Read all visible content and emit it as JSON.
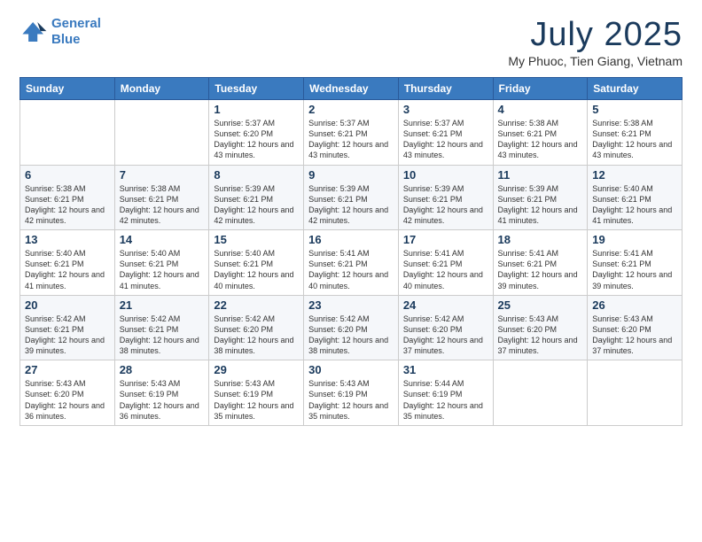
{
  "logo": {
    "line1": "General",
    "line2": "Blue"
  },
  "title": "July 2025",
  "subtitle": "My Phuoc, Tien Giang, Vietnam",
  "days_of_week": [
    "Sunday",
    "Monday",
    "Tuesday",
    "Wednesday",
    "Thursday",
    "Friday",
    "Saturday"
  ],
  "weeks": [
    [
      {
        "day": "",
        "content": ""
      },
      {
        "day": "",
        "content": ""
      },
      {
        "day": "1",
        "content": "Sunrise: 5:37 AM\nSunset: 6:20 PM\nDaylight: 12 hours and 43 minutes."
      },
      {
        "day": "2",
        "content": "Sunrise: 5:37 AM\nSunset: 6:21 PM\nDaylight: 12 hours and 43 minutes."
      },
      {
        "day": "3",
        "content": "Sunrise: 5:37 AM\nSunset: 6:21 PM\nDaylight: 12 hours and 43 minutes."
      },
      {
        "day": "4",
        "content": "Sunrise: 5:38 AM\nSunset: 6:21 PM\nDaylight: 12 hours and 43 minutes."
      },
      {
        "day": "5",
        "content": "Sunrise: 5:38 AM\nSunset: 6:21 PM\nDaylight: 12 hours and 43 minutes."
      }
    ],
    [
      {
        "day": "6",
        "content": "Sunrise: 5:38 AM\nSunset: 6:21 PM\nDaylight: 12 hours and 42 minutes."
      },
      {
        "day": "7",
        "content": "Sunrise: 5:38 AM\nSunset: 6:21 PM\nDaylight: 12 hours and 42 minutes."
      },
      {
        "day": "8",
        "content": "Sunrise: 5:39 AM\nSunset: 6:21 PM\nDaylight: 12 hours and 42 minutes."
      },
      {
        "day": "9",
        "content": "Sunrise: 5:39 AM\nSunset: 6:21 PM\nDaylight: 12 hours and 42 minutes."
      },
      {
        "day": "10",
        "content": "Sunrise: 5:39 AM\nSunset: 6:21 PM\nDaylight: 12 hours and 42 minutes."
      },
      {
        "day": "11",
        "content": "Sunrise: 5:39 AM\nSunset: 6:21 PM\nDaylight: 12 hours and 41 minutes."
      },
      {
        "day": "12",
        "content": "Sunrise: 5:40 AM\nSunset: 6:21 PM\nDaylight: 12 hours and 41 minutes."
      }
    ],
    [
      {
        "day": "13",
        "content": "Sunrise: 5:40 AM\nSunset: 6:21 PM\nDaylight: 12 hours and 41 minutes."
      },
      {
        "day": "14",
        "content": "Sunrise: 5:40 AM\nSunset: 6:21 PM\nDaylight: 12 hours and 41 minutes."
      },
      {
        "day": "15",
        "content": "Sunrise: 5:40 AM\nSunset: 6:21 PM\nDaylight: 12 hours and 40 minutes."
      },
      {
        "day": "16",
        "content": "Sunrise: 5:41 AM\nSunset: 6:21 PM\nDaylight: 12 hours and 40 minutes."
      },
      {
        "day": "17",
        "content": "Sunrise: 5:41 AM\nSunset: 6:21 PM\nDaylight: 12 hours and 40 minutes."
      },
      {
        "day": "18",
        "content": "Sunrise: 5:41 AM\nSunset: 6:21 PM\nDaylight: 12 hours and 39 minutes."
      },
      {
        "day": "19",
        "content": "Sunrise: 5:41 AM\nSunset: 6:21 PM\nDaylight: 12 hours and 39 minutes."
      }
    ],
    [
      {
        "day": "20",
        "content": "Sunrise: 5:42 AM\nSunset: 6:21 PM\nDaylight: 12 hours and 39 minutes."
      },
      {
        "day": "21",
        "content": "Sunrise: 5:42 AM\nSunset: 6:21 PM\nDaylight: 12 hours and 38 minutes."
      },
      {
        "day": "22",
        "content": "Sunrise: 5:42 AM\nSunset: 6:20 PM\nDaylight: 12 hours and 38 minutes."
      },
      {
        "day": "23",
        "content": "Sunrise: 5:42 AM\nSunset: 6:20 PM\nDaylight: 12 hours and 38 minutes."
      },
      {
        "day": "24",
        "content": "Sunrise: 5:42 AM\nSunset: 6:20 PM\nDaylight: 12 hours and 37 minutes."
      },
      {
        "day": "25",
        "content": "Sunrise: 5:43 AM\nSunset: 6:20 PM\nDaylight: 12 hours and 37 minutes."
      },
      {
        "day": "26",
        "content": "Sunrise: 5:43 AM\nSunset: 6:20 PM\nDaylight: 12 hours and 37 minutes."
      }
    ],
    [
      {
        "day": "27",
        "content": "Sunrise: 5:43 AM\nSunset: 6:20 PM\nDaylight: 12 hours and 36 minutes."
      },
      {
        "day": "28",
        "content": "Sunrise: 5:43 AM\nSunset: 6:19 PM\nDaylight: 12 hours and 36 minutes."
      },
      {
        "day": "29",
        "content": "Sunrise: 5:43 AM\nSunset: 6:19 PM\nDaylight: 12 hours and 35 minutes."
      },
      {
        "day": "30",
        "content": "Sunrise: 5:43 AM\nSunset: 6:19 PM\nDaylight: 12 hours and 35 minutes."
      },
      {
        "day": "31",
        "content": "Sunrise: 5:44 AM\nSunset: 6:19 PM\nDaylight: 12 hours and 35 minutes."
      },
      {
        "day": "",
        "content": ""
      },
      {
        "day": "",
        "content": ""
      }
    ]
  ]
}
